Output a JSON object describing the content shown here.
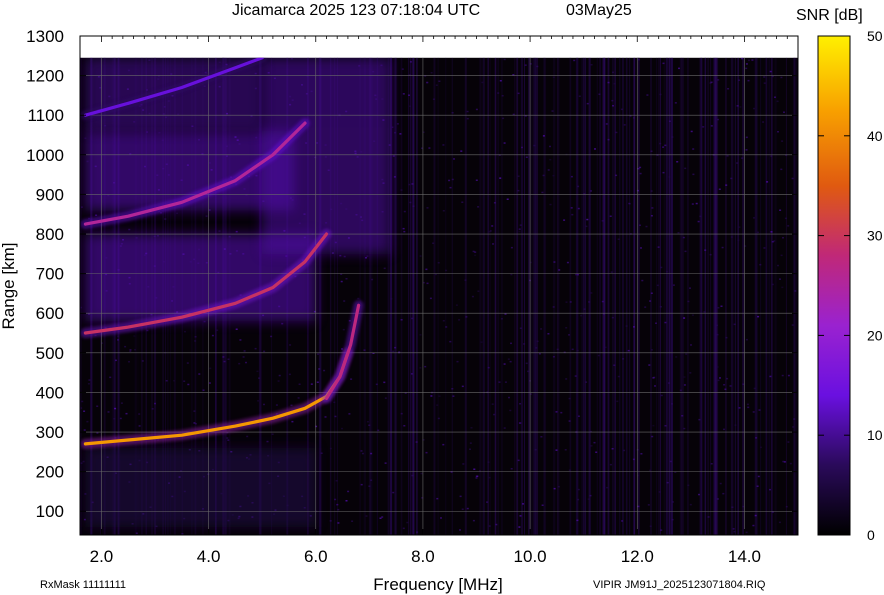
{
  "header": {
    "title": "Jicamarca 2025 123 07:18:04 UTC",
    "date": "03May25",
    "colorbar_title": "SNR [dB]"
  },
  "footer": {
    "left": "RxMask 11111111",
    "right": "VIPIR  JM91J_2025123071804.RIQ"
  },
  "chart_data": {
    "type": "heatmap",
    "title": "Jicamarca 2025 123 07:18:04 UTC",
    "xlabel": "Frequency [MHz]",
    "ylabel": "Range [km]",
    "xlim": [
      1.6,
      15.0
    ],
    "ylim": [
      40,
      1300
    ],
    "data_top_range_km": 1245,
    "x_ticks": [
      2.0,
      4.0,
      6.0,
      8.0,
      10.0,
      12.0,
      14.0
    ],
    "x_tick_labels": [
      "2.0",
      "4.0",
      "6.0",
      "8.0",
      "10.0",
      "12.0",
      "14.0"
    ],
    "y_ticks": [
      100,
      200,
      300,
      400,
      500,
      600,
      700,
      800,
      900,
      1000,
      1100,
      1200,
      1300
    ],
    "y_tick_labels": [
      "100",
      "200",
      "300",
      "400",
      "500",
      "600",
      "700",
      "800",
      "900",
      "1000",
      "1100",
      "1200",
      "1300"
    ],
    "grid": true,
    "colorbar": {
      "label": "SNR [dB]",
      "range": [
        0,
        50
      ],
      "ticks": [
        0,
        10,
        20,
        30,
        40,
        50
      ],
      "tick_labels": [
        "0",
        "10",
        "20",
        "30",
        "40",
        "50"
      ],
      "colors": [
        "#000000",
        "#2a0a5a",
        "#6a10e0",
        "#9a22d0",
        "#c02878",
        "#e05a10",
        "#f8a000",
        "#fff000"
      ]
    },
    "traces": [
      {
        "name": "",
        "snr_db": 42,
        "x": [
          1.7,
          2.5,
          3.5,
          4.5,
          5.2,
          5.8,
          6.2,
          6.45,
          6.6
        ],
        "y": [
          270,
          280,
          292,
          315,
          335,
          360,
          390,
          440,
          500
        ]
      },
      {
        "name": "",
        "snr_db": 28,
        "x": [
          6.2,
          6.45,
          6.65,
          6.8
        ],
        "y": [
          385,
          440,
          520,
          620
        ]
      },
      {
        "name": "",
        "snr_db": 30,
        "x": [
          1.7,
          2.5,
          3.5,
          4.5,
          5.2,
          5.8,
          6.2
        ],
        "y": [
          550,
          565,
          590,
          625,
          665,
          730,
          800
        ]
      },
      {
        "name": "",
        "snr_db": 26,
        "x": [
          1.7,
          2.5,
          3.5,
          4.5,
          5.2,
          5.8
        ],
        "y": [
          825,
          845,
          880,
          935,
          1000,
          1080
        ]
      },
      {
        "name": "",
        "snr_db": 14,
        "x": [
          1.7,
          2.5,
          3.5,
          4.5,
          5.0
        ],
        "y": [
          1100,
          1130,
          1170,
          1220,
          1245
        ]
      }
    ],
    "diffuse_regions": [
      {
        "snr_db": 12,
        "x_range": [
          1.7,
          6.0
        ],
        "y_range": [
          580,
          800
        ]
      },
      {
        "snr_db": 12,
        "x_range": [
          1.7,
          5.6
        ],
        "y_range": [
          860,
          1060
        ]
      },
      {
        "snr_db": 11,
        "x_range": [
          5.0,
          7.4
        ],
        "y_range": [
          750,
          1245
        ]
      },
      {
        "snr_db": 10,
        "x_range": [
          1.7,
          5.0
        ],
        "y_range": [
          1060,
          1245
        ]
      },
      {
        "snr_db": 6,
        "x_range": [
          1.7,
          6.0
        ],
        "y_range": [
          60,
          260
        ]
      }
    ]
  }
}
